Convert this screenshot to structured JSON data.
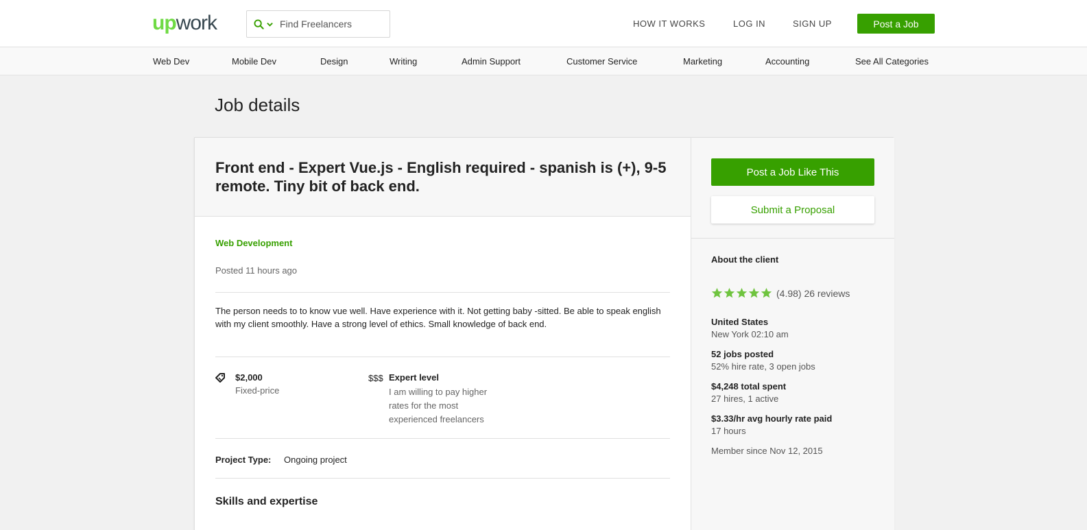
{
  "header": {
    "logo_up": "up",
    "logo_work": "work",
    "search_placeholder": "Find Freelancers",
    "nav": [
      "HOW IT WORKS",
      "LOG IN",
      "SIGN UP"
    ],
    "post_job": "Post a Job"
  },
  "categories": [
    "Web Dev",
    "Mobile Dev",
    "Design",
    "Writing",
    "Admin Support",
    "Customer Service",
    "Marketing",
    "Accounting",
    "See All Categories"
  ],
  "page_title": "Job details",
  "job": {
    "title": "Front end - Expert Vue.js - English required - spanish is (+), 9-5 remote. Tiny bit of back end.",
    "category": "Web Development",
    "posted": "Posted 11 hours ago",
    "description": "The person needs to to know vue well. Have experience with it. Not getting baby -sitted. Be able to speak english with my client smoothly. Have a strong level of ethics.  Small knowledge of back end.",
    "price": "$2,000",
    "price_type": "Fixed-price",
    "level_icon": "$$$",
    "level": "Expert level",
    "level_desc": "I am willing to pay higher rates for the most experienced freelancers",
    "project_type_label": "Project Type:",
    "project_type": "Ongoing project",
    "skills_heading": "Skills and expertise"
  },
  "sidebar": {
    "post_like_this": "Post a Job Like This",
    "submit_proposal": "Submit a Proposal",
    "about": "About the client",
    "rating_text": "(4.98) 26 reviews",
    "rating_value": 4.98,
    "stars": 5,
    "country": "United States",
    "local_time": "New York 02:10 am",
    "jobs_posted": "52 jobs posted",
    "hire_rate": "52% hire rate, 3 open jobs",
    "total_spent": "$4,248 total spent",
    "hires": "27 hires, 1 active",
    "avg_rate_amount": "$3.33",
    "avg_rate_unit": "/hr",
    "avg_rate_label": "avg hourly rate paid",
    "hours": "17 hours",
    "member_since": "Member since Nov 12, 2015"
  },
  "colors": {
    "brand_green": "#37a000",
    "logo_green": "#6fda44",
    "star_green": "#6fc43f"
  },
  "icons": [
    "search-icon",
    "chevron-down-icon",
    "price-tag-icon",
    "star-icon"
  ]
}
